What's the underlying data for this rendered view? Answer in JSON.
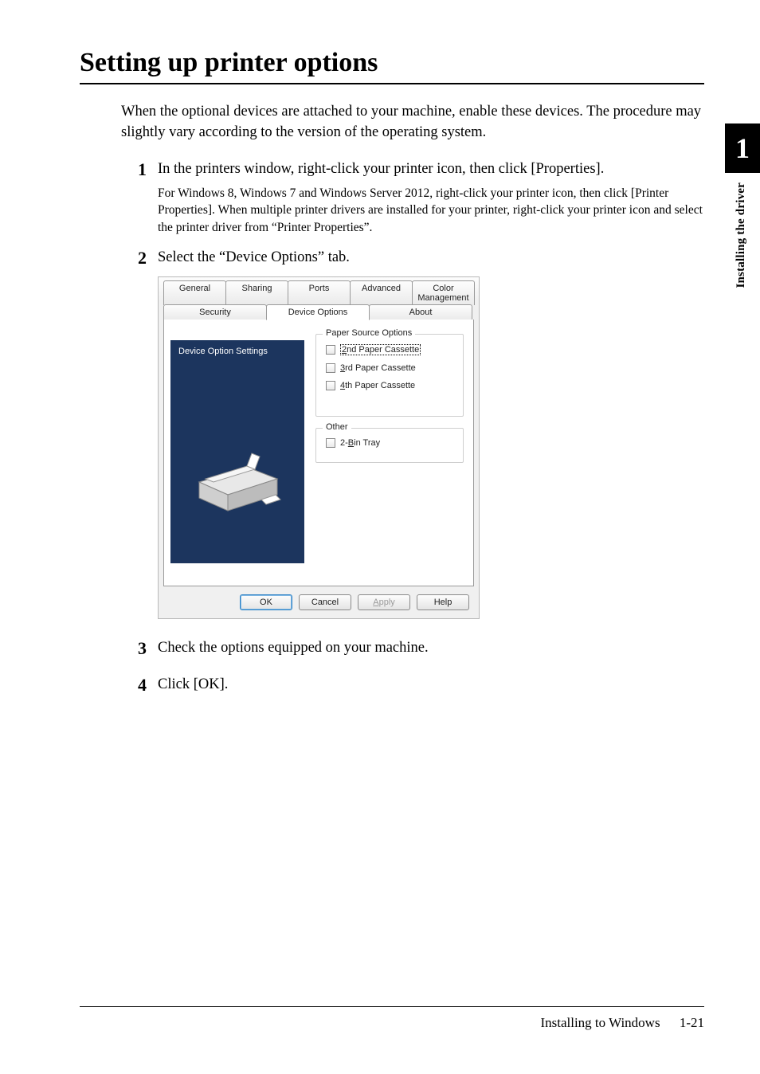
{
  "side_tab": {
    "chapter_num": "1",
    "label": "Installing the driver"
  },
  "title": "Setting up printer options",
  "intro": "When the optional devices are attached to your machine, enable these devices. The procedure may slightly vary according to the version of the operating system.",
  "steps": [
    {
      "num": "1",
      "main": "In the printers window, right-click your printer icon, then click [Properties].",
      "sub": "For Windows 8, Windows 7 and Windows Server 2012, right-click your printer icon, then click [Printer Properties].  When multiple printer drivers are installed for your printer, right-click your printer icon and select the printer driver from “Printer Properties”."
    },
    {
      "num": "2",
      "main": "Select the “Device Options” tab."
    },
    {
      "num": "3",
      "main": "Check the options equipped on your machine."
    },
    {
      "num": "4",
      "main": "Click [OK]."
    }
  ],
  "dialog": {
    "tabs_top": [
      "General",
      "Sharing",
      "Ports",
      "Advanced",
      "Color Management"
    ],
    "tabs_bottom": [
      {
        "label": "Security",
        "active": false
      },
      {
        "label": "Device Options",
        "active": true
      },
      {
        "label": "About",
        "active": false
      }
    ],
    "left_panel_title": "Device Option Settings",
    "group1_title": "Paper Source Options",
    "group1_items": [
      {
        "u": "2",
        "rest": "nd Paper Cassette",
        "highlight": true
      },
      {
        "u": "3",
        "rest": "rd Paper Cassette",
        "highlight": false
      },
      {
        "u": "4",
        "rest": "th Paper Cassette",
        "highlight": false
      }
    ],
    "group2_title": "Other",
    "group2_items": [
      {
        "pre": "2-",
        "u": "B",
        "rest": "in Tray",
        "highlight": false
      }
    ],
    "buttons": {
      "ok": "OK",
      "cancel": "Cancel",
      "apply": "Apply",
      "help": "Help"
    }
  },
  "footer": {
    "section": "Installing to Windows",
    "page": "1-21"
  }
}
